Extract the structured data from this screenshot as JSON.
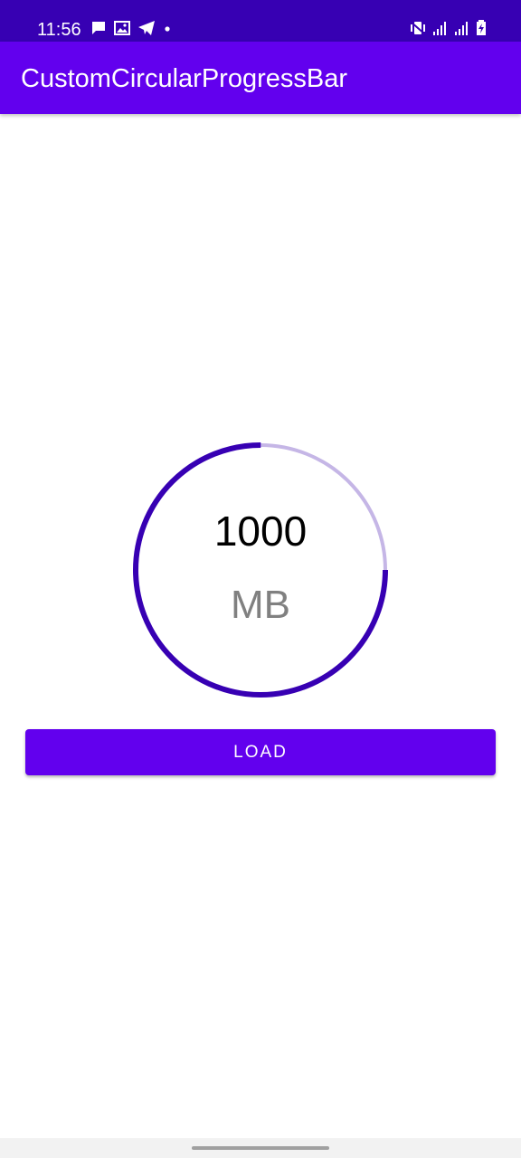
{
  "status_bar": {
    "time": "11:56",
    "icons_left": [
      "message-icon",
      "image-icon",
      "telegram-icon",
      "dot-icon"
    ],
    "icons_right": [
      "vibrate-icon",
      "signal-icon",
      "signal-icon",
      "battery-charging-icon"
    ]
  },
  "app_bar": {
    "title": "CustomCircularProgressBar"
  },
  "progress": {
    "value": "1000",
    "unit": "MB",
    "fraction": 0.75,
    "progress_color": "#3700b3",
    "track_color": "#c5b6e6"
  },
  "actions": {
    "load_label": "LOAD"
  },
  "colors": {
    "primary": "#6200ee",
    "primary_dark": "#3700b3"
  }
}
